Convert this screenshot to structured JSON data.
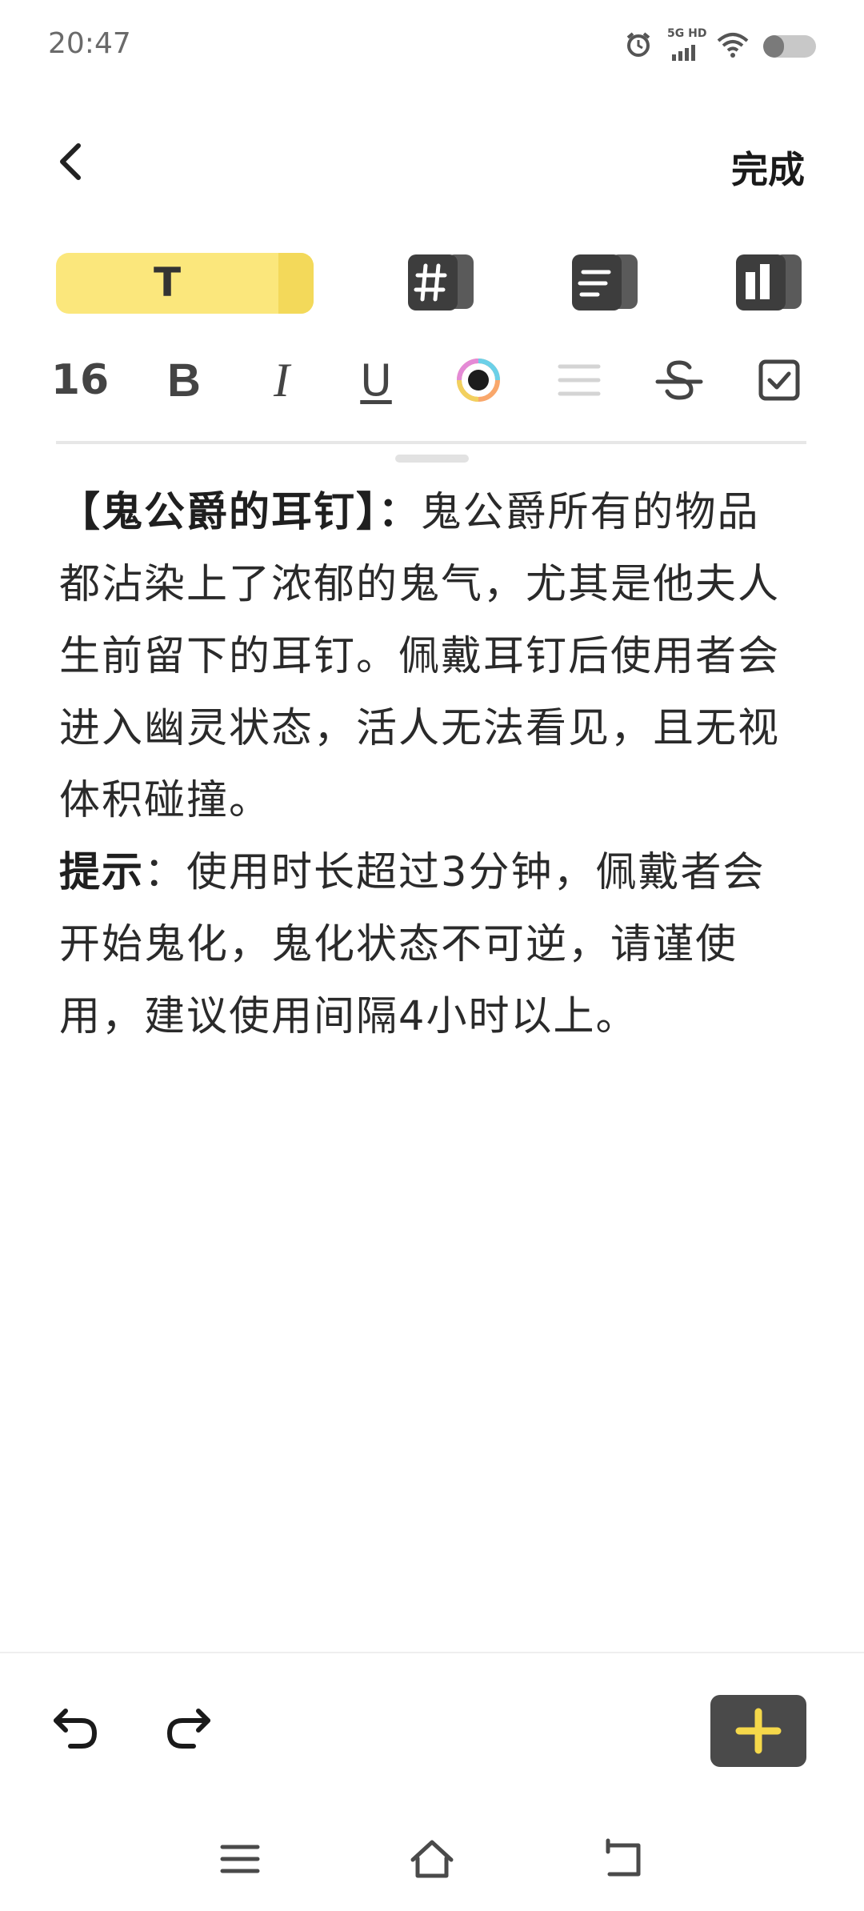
{
  "status_bar": {
    "time": "20:47",
    "network": "5G HD",
    "icons": [
      "alarm-icon",
      "cellular-signal-icon",
      "wifi-icon",
      "battery-icon"
    ]
  },
  "header": {
    "back_icon": "chevron-left-icon",
    "done_label": "完成"
  },
  "style_tabs": {
    "items": [
      {
        "name": "text-style",
        "label": "T",
        "active": true
      },
      {
        "name": "heading-style",
        "icon": "hash-icon",
        "active": false
      },
      {
        "name": "list-style",
        "icon": "list-lines-icon",
        "active": false
      },
      {
        "name": "layout-style",
        "icon": "columns-icon",
        "active": false
      }
    ]
  },
  "format_bar": {
    "font_size": "16",
    "bold": "B",
    "italic": "I",
    "underline": "U",
    "icons": [
      "color-picker-icon",
      "align-icon",
      "strikethrough-icon",
      "checkbox-icon"
    ]
  },
  "content": {
    "title_bold": "【鬼公爵的耳钉】：",
    "paragraph1": "鬼公爵所有的物品都沾染上了浓郁的鬼气，尤其是他夫人生前留下的耳钉。佩戴耳钉后使用者会进入幽灵状态，活人无法看见，且无视体积碰撞。",
    "tip_bold": "提示",
    "tip_text": "：使用时长超过3分钟，佩戴者会开始鬼化，鬼化状态不可逆，请谨使用，建议使用间隔4小时以上。"
  },
  "bottom_toolbar": {
    "icons": [
      "undo-icon",
      "redo-icon",
      "add-icon"
    ]
  },
  "nav_bar": {
    "icons": [
      "menu-icon",
      "home-icon",
      "back-icon"
    ]
  },
  "colors": {
    "accent_yellow": "#fbe77c",
    "dark_button": "#4a4a4a",
    "plus_yellow": "#f5d84a"
  }
}
